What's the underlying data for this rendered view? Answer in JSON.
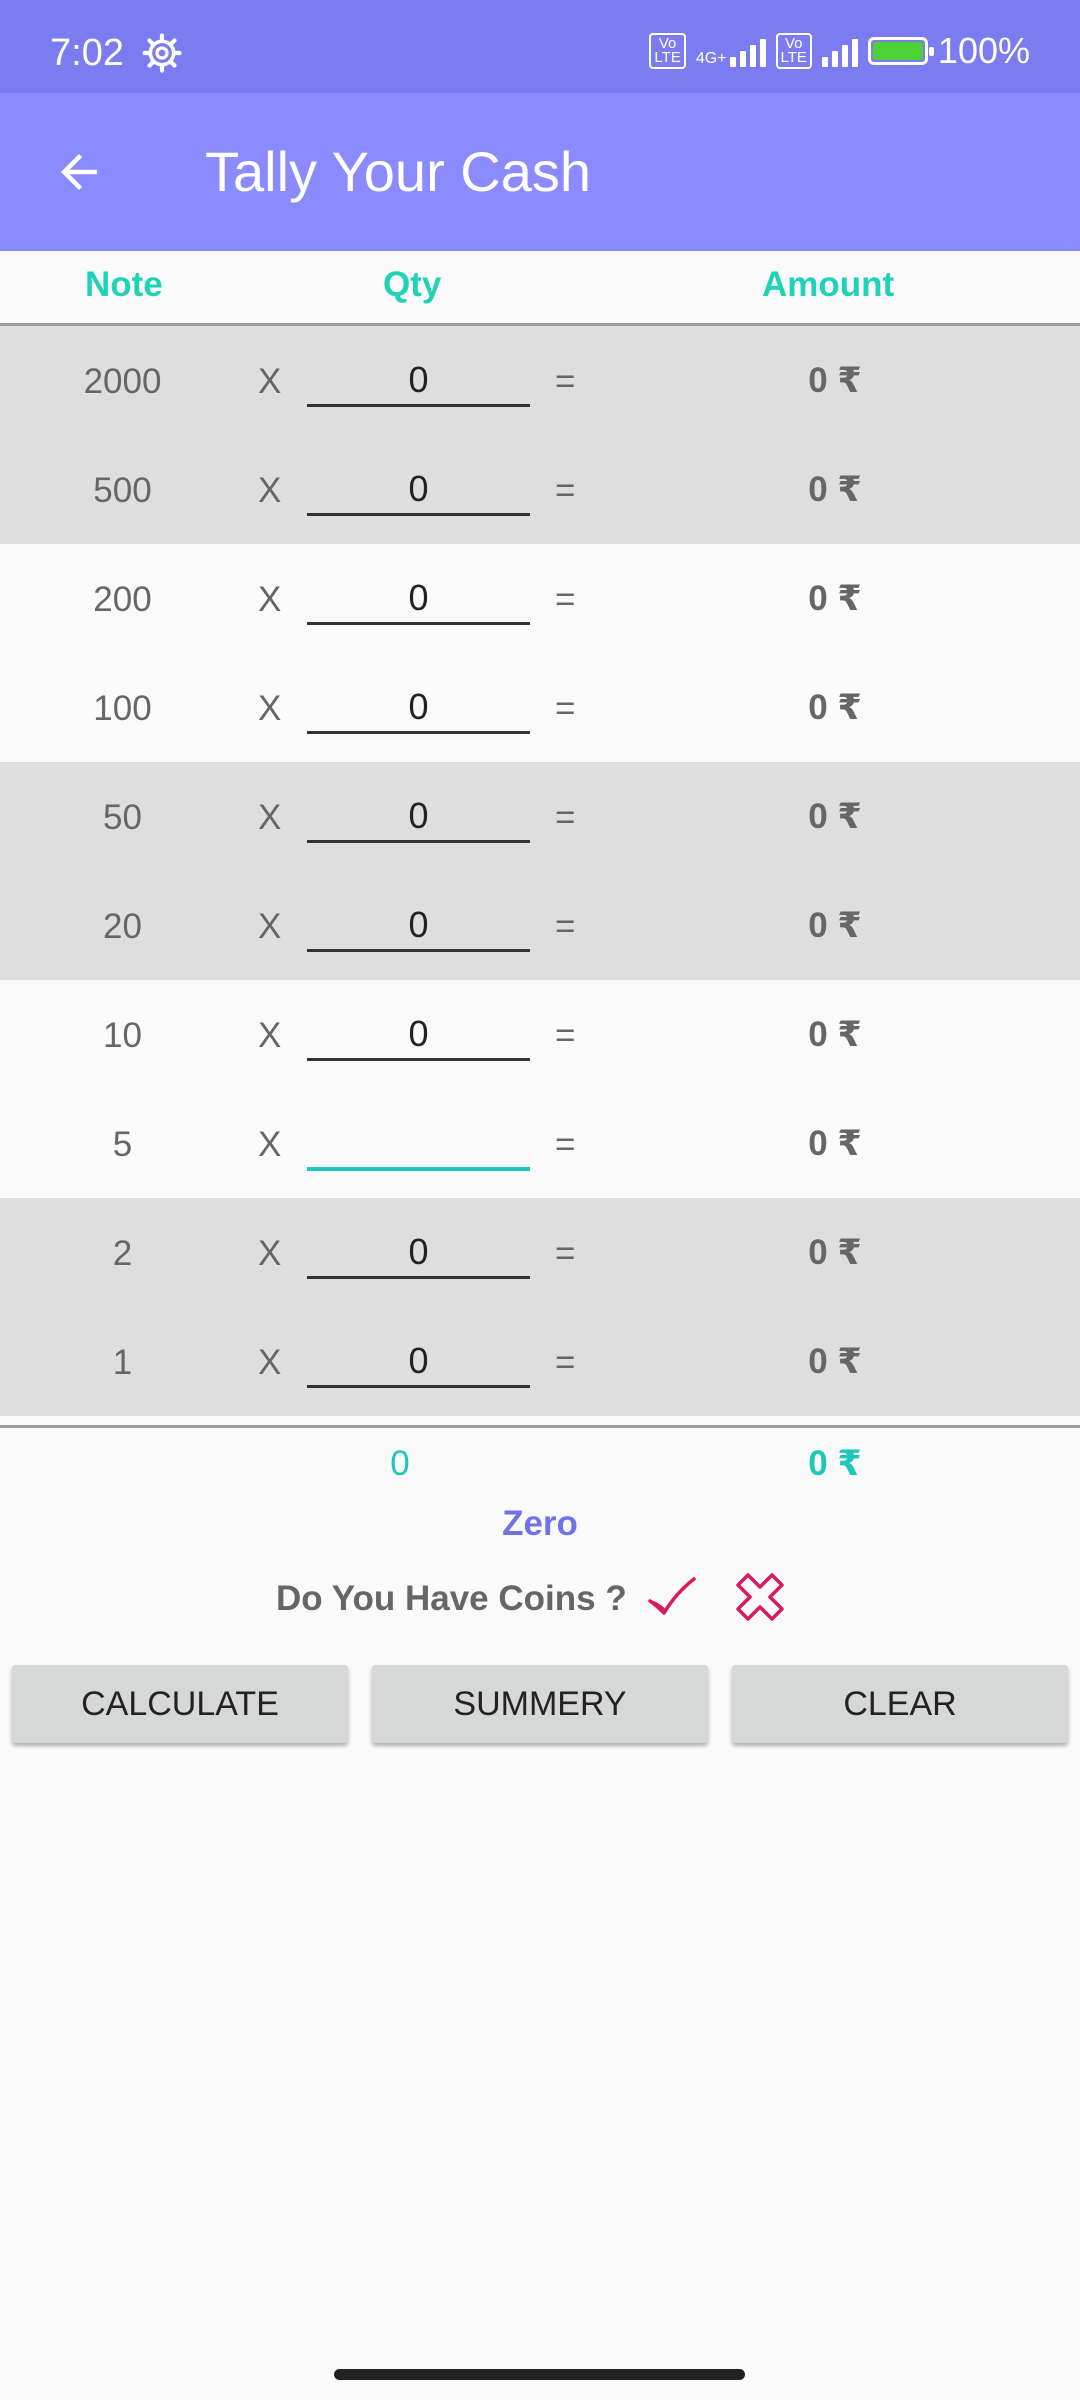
{
  "status_bar": {
    "time": "7:02",
    "network_1": "4G+",
    "volte_label": "Vo LTE",
    "battery": "100%"
  },
  "app_bar": {
    "title": "Tally Your Cash"
  },
  "table": {
    "headers": {
      "note": "Note",
      "qty": "Qty",
      "amount": "Amount"
    },
    "rows": [
      {
        "note": "2000",
        "x": "X",
        "qty": "0",
        "eq": "=",
        "amount": "0 ₹"
      },
      {
        "note": "500",
        "x": "X",
        "qty": "0",
        "eq": "=",
        "amount": "0 ₹"
      },
      {
        "note": "200",
        "x": "X",
        "qty": "0",
        "eq": "=",
        "amount": "0 ₹"
      },
      {
        "note": "100",
        "x": "X",
        "qty": "0",
        "eq": "=",
        "amount": "0 ₹"
      },
      {
        "note": "50",
        "x": "X",
        "qty": "0",
        "eq": "=",
        "amount": "0 ₹"
      },
      {
        "note": "20",
        "x": "X",
        "qty": "0",
        "eq": "=",
        "amount": "0 ₹"
      },
      {
        "note": "10",
        "x": "X",
        "qty": "0",
        "eq": "=",
        "amount": "0 ₹"
      },
      {
        "note": "5",
        "x": "X",
        "qty": "",
        "eq": "=",
        "amount": "0 ₹"
      },
      {
        "note": "2",
        "x": "X",
        "qty": "0",
        "eq": "=",
        "amount": "0 ₹"
      },
      {
        "note": "1",
        "x": "X",
        "qty": "0",
        "eq": "=",
        "amount": "0 ₹"
      }
    ]
  },
  "totals": {
    "qty": "0",
    "amount": "0 ₹",
    "in_words": "Zero"
  },
  "coins": {
    "question": "Do You Have Coins ?",
    "yes_icon": "check-icon",
    "no_icon": "cross-icon"
  },
  "buttons": {
    "calculate": "CALCULATE",
    "summary": "SUMMERY",
    "clear": "CLEAR"
  },
  "colors": {
    "status_bar": "#7b7cf0",
    "app_bar": "#8a8bff",
    "accent_teal": "#1ed3b7",
    "accent_purple": "#7172e6",
    "icon_red": "#d81b60"
  }
}
